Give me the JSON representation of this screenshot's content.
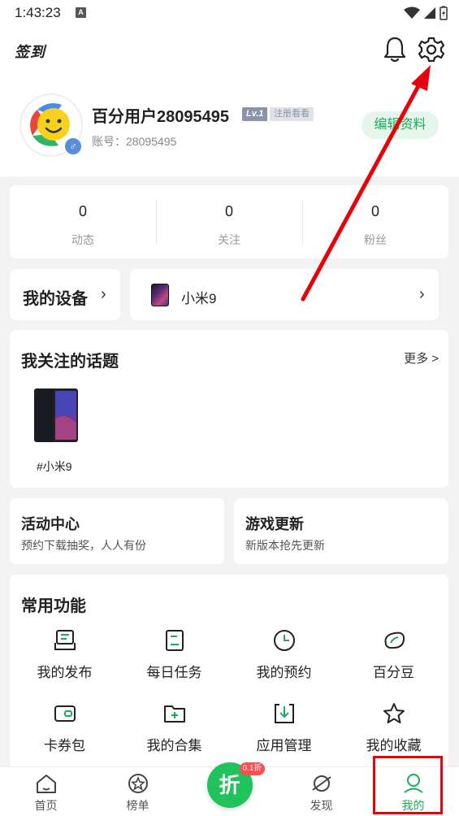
{
  "status_bar": {
    "time": "1:43:23",
    "a_icon": "A"
  },
  "header": {
    "checkin_label": "签到"
  },
  "profile": {
    "username": "百分用户28095495",
    "level": "Lv.1",
    "register_hint": "注册看看",
    "account": "账号：28095495",
    "gender_symbol": "♂",
    "edit_label": "编辑资料"
  },
  "stats": [
    {
      "value": "0",
      "label": "动态"
    },
    {
      "value": "0",
      "label": "关注"
    },
    {
      "value": "0",
      "label": "粉丝"
    }
  ],
  "device": {
    "title": "我的设备",
    "name": "小米9"
  },
  "topics": {
    "title": "我关注的话题",
    "more": "更多 >",
    "items": [
      {
        "label": "#小米9"
      }
    ]
  },
  "promos": [
    {
      "title": "活动中心",
      "subtitle": "预约下载抽奖，人人有份"
    },
    {
      "title": "游戏更新",
      "subtitle": "新版本抢先更新"
    }
  ],
  "common": {
    "title": "常用功能",
    "items": [
      {
        "label": "我的发布",
        "icon": "publish-icon"
      },
      {
        "label": "每日任务",
        "icon": "task-icon"
      },
      {
        "label": "我的预约",
        "icon": "clock-icon"
      },
      {
        "label": "百分豆",
        "icon": "bean-icon"
      },
      {
        "label": "卡券包",
        "icon": "wallet-icon"
      },
      {
        "label": "我的合集",
        "icon": "collection-icon"
      },
      {
        "label": "应用管理",
        "icon": "download-icon"
      },
      {
        "label": "我的收藏",
        "icon": "star-icon"
      }
    ]
  },
  "tabbar": {
    "items": [
      {
        "label": "首页"
      },
      {
        "label": "榜单"
      },
      {
        "label": "",
        "center_text": "折",
        "badge": "0.1折"
      },
      {
        "label": "发现"
      },
      {
        "label": "我的"
      }
    ],
    "active_index": 4
  },
  "colors": {
    "accent": "#1aad5a",
    "annotation": "#e8000b",
    "background": "#f3f3f3"
  }
}
